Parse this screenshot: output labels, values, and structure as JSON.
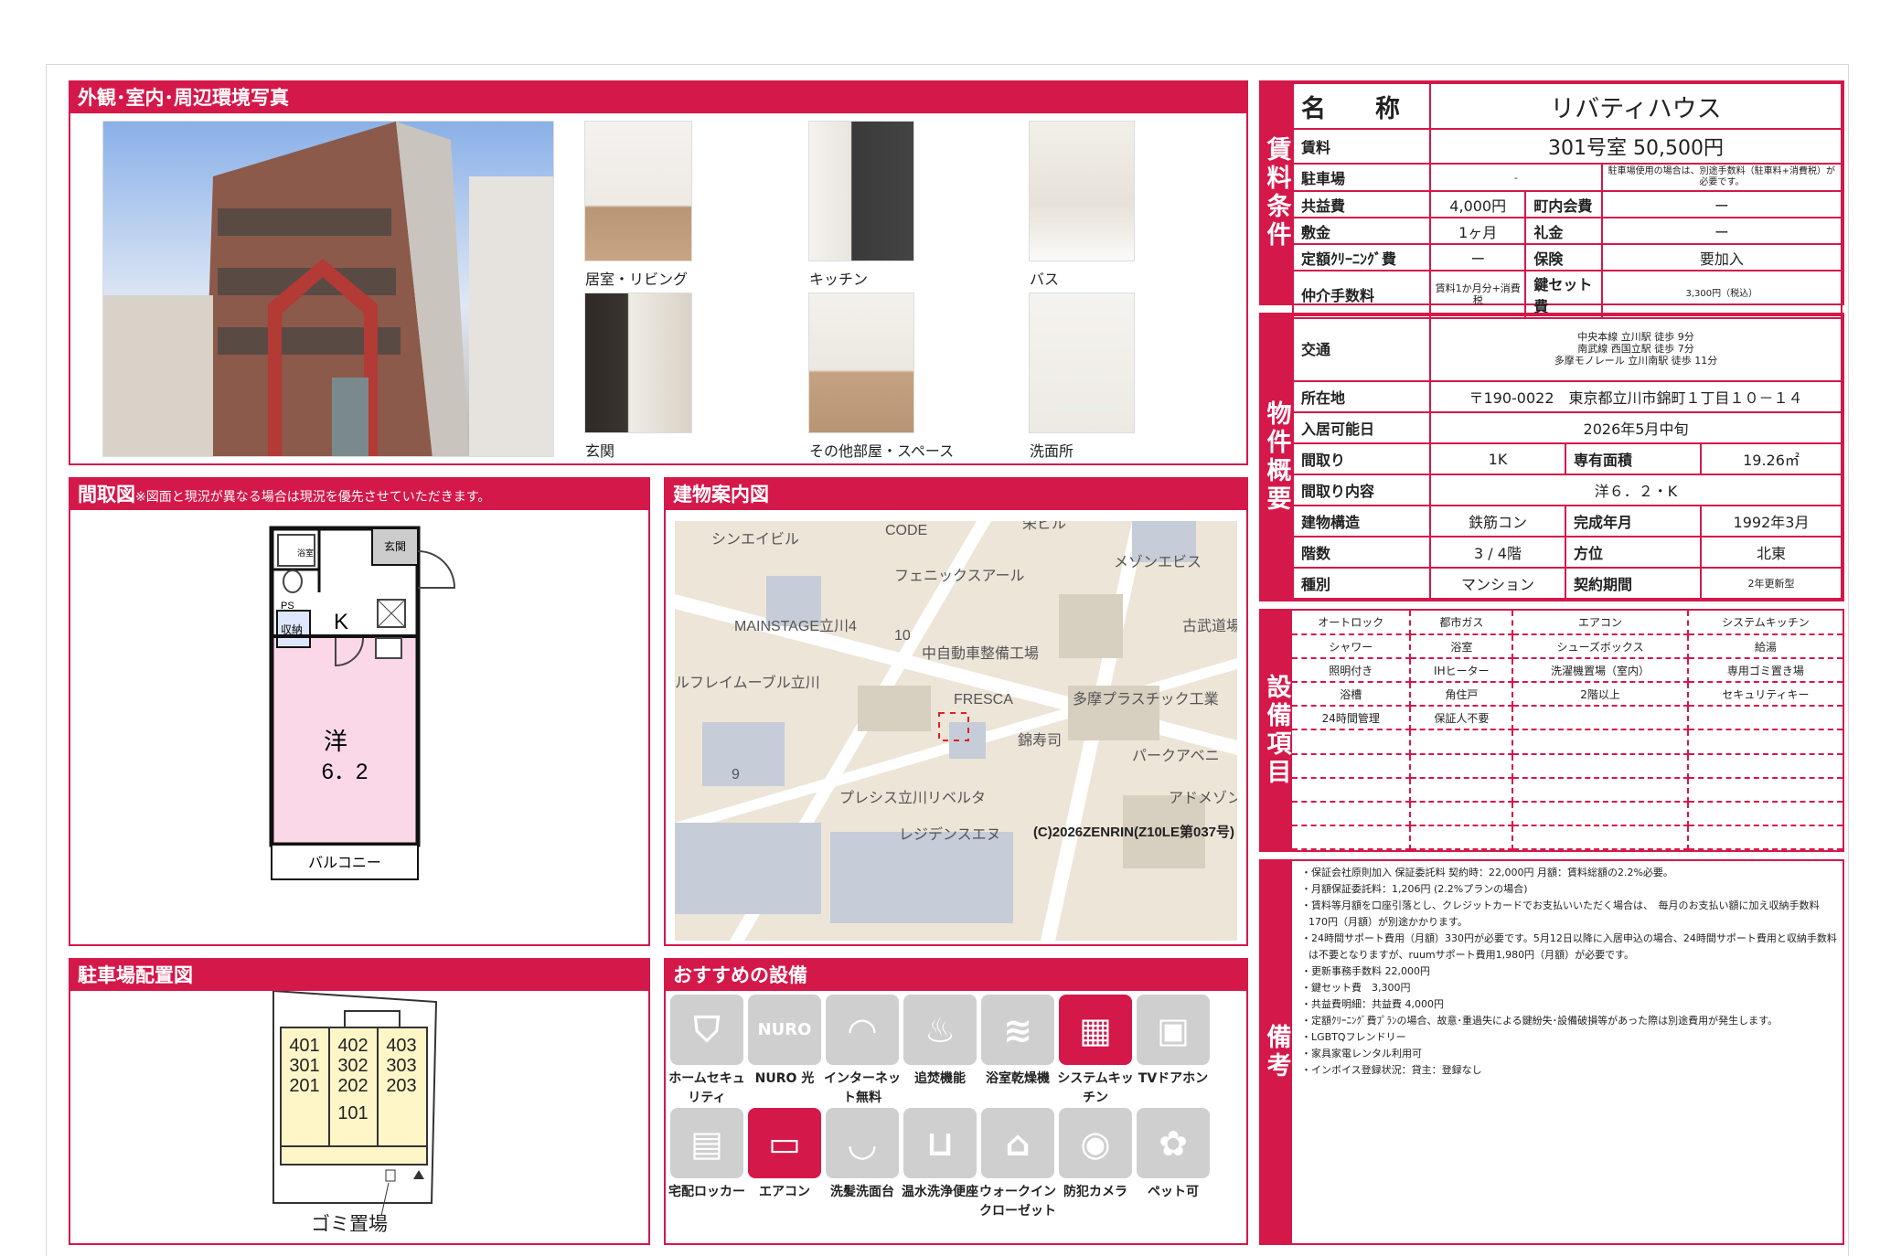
{
  "colors": {
    "accent": "#d4184a",
    "map_bg": "#ece5d8",
    "room_pink": "#fbd8e8",
    "room_yellow": "#fff6c8"
  },
  "photos": {
    "title": "外観･室内･周辺環境写真",
    "captions": [
      "居室・リビング",
      "キッチン",
      "バス",
      "玄関",
      "その他部屋・スペース",
      "洗面所"
    ]
  },
  "floorplan": {
    "title": "間取図",
    "note": "※図面と現況が異なる場合は現況を優先させていただきます。",
    "labels": {
      "entrance": "玄関",
      "kitchen": "K",
      "ps": "PS",
      "storage": "収納",
      "wc": "浴室",
      "room": "洋",
      "room_size": "6．2",
      "balcony": "バルコニー"
    }
  },
  "map": {
    "title": "建物案内図",
    "labels": [
      "シンエイビル",
      "CODE",
      "栄ビル",
      "メゾンエビス",
      "フェニックスアール",
      "MAINSTAGE立川4",
      "10",
      "古武道場",
      "中自動車整備工場",
      "ルフレイムーブル立川",
      "FRESCA",
      "多摩プラスチック工業",
      "錦寿司",
      "パークアベニ",
      "9",
      "プレシス立川リベルタ",
      "アドメゾン",
      "レジデンスエヌ"
    ],
    "copyright": "(C)2026ZENRIN(Z10LE第037号)"
  },
  "parking": {
    "title": "駐車場配置図",
    "rooms": [
      [
        "401",
        "402",
        "403"
      ],
      [
        "301",
        "302",
        "303"
      ],
      [
        "201",
        "202",
        "203"
      ],
      [
        "",
        "101",
        ""
      ]
    ],
    "garbage": "ゴミ置場"
  },
  "facilities_icons": {
    "title": "おすすめの設備",
    "items": [
      {
        "label": "ホームセキュリティ",
        "on": false,
        "icon": "shield-icon"
      },
      {
        "label": "NURO 光",
        "on": false,
        "icon": "nuro-icon"
      },
      {
        "label": "インターネット無料",
        "on": false,
        "icon": "wifi-icon"
      },
      {
        "label": "追焚機能",
        "on": false,
        "icon": "bathtub-icon"
      },
      {
        "label": "浴室乾燥機",
        "on": false,
        "icon": "dryer-icon"
      },
      {
        "label": "システムキッチン",
        "on": true,
        "icon": "kitchen-icon"
      },
      {
        "label": "TVドアホン",
        "on": false,
        "icon": "intercom-icon"
      },
      {
        "label": "宅配ロッカー",
        "on": false,
        "icon": "locker-icon"
      },
      {
        "label": "エアコン",
        "on": true,
        "icon": "aircon-icon"
      },
      {
        "label": "洗髪洗面台",
        "on": false,
        "icon": "washbasin-icon"
      },
      {
        "label": "温水洗浄便座",
        "on": false,
        "icon": "toilet-icon"
      },
      {
        "label": "ウォークインクローゼット",
        "on": false,
        "icon": "closet-icon"
      },
      {
        "label": "防犯カメラ",
        "on": false,
        "icon": "camera-icon"
      },
      {
        "label": "ペット可",
        "on": false,
        "icon": "paw-icon"
      }
    ]
  },
  "rent": {
    "section": "賃料条件",
    "name_label": "名　　称",
    "name": "リバティハウス",
    "rent_label": "賃料",
    "rent": "301号室 50,500円",
    "parking_label": "駐車場",
    "parking": "-",
    "parking_note": "駐車場使用の場合は、別途手数料（駐車料+消費税）が必要です。",
    "common_label": "共益費",
    "common": "4,000円",
    "assoc_label": "町内会費",
    "assoc": "ー",
    "deposit_label": "敷金",
    "deposit": "1ヶ月",
    "key_money_label": "礼金",
    "key_money": "ー",
    "cleaning_label": "定額ｸﾘｰﾆﾝｸﾞ費",
    "cleaning": "ー",
    "insurance_label": "保険",
    "insurance": "要加入",
    "broker_label": "仲介手数料",
    "broker": "賃料1か月分+消費税",
    "keyset_label": "鍵セット費",
    "keyset": "3,300円（税込）"
  },
  "property": {
    "section": "物件概要",
    "access_label": "交通",
    "access": [
      "中央本線 立川駅 徒歩 9分",
      "南武線 西国立駅 徒歩 7分",
      "多摩モノレール 立川南駅 徒歩 11分"
    ],
    "address_label": "所在地",
    "address": "〒190-0022　東京都立川市錦町１丁目１０－１４",
    "movein_label": "入居可能日",
    "movein": "2026年5月中旬",
    "layout_label": "間取り",
    "layout": "1K",
    "area_label": "専有面積",
    "area": "19.26㎡",
    "detail_label": "間取り内容",
    "detail": "洋６．２・K",
    "structure_label": "建物構造",
    "structure": "鉄筋コン",
    "built_label": "完成年月",
    "built": "1992年3月",
    "floor_label": "階数",
    "floor": "3 / 4階",
    "direction_label": "方位",
    "direction": "北東",
    "type_label": "種別",
    "type": "マンション",
    "contract_label": "契約期間",
    "contract": "2年更新型"
  },
  "equipment": {
    "section": "設備項目",
    "rows": [
      [
        "オートロック",
        "都市ガス",
        "エアコン",
        "システムキッチン"
      ],
      [
        "シャワー",
        "浴室",
        "シューズボックス",
        "給湯"
      ],
      [
        "照明付き",
        "IHヒーター",
        "洗濯機置場（室内）",
        "専用ゴミ置き場"
      ],
      [
        "浴槽",
        "角住戸",
        "2階以上",
        "セキュリティキー"
      ],
      [
        "24時間管理",
        "保証人不要",
        "",
        ""
      ],
      [
        "",
        "",
        "",
        ""
      ],
      [
        "",
        "",
        "",
        ""
      ],
      [
        "",
        "",
        "",
        ""
      ],
      [
        "",
        "",
        "",
        ""
      ],
      [
        "",
        "",
        "",
        ""
      ]
    ]
  },
  "remarks": {
    "section": "備考",
    "lines": [
      "・保証会社原則加入 保証委託料 契約時：22,000円 月額：賃料総額の2.2%必要。",
      "・月額保証委託料：1,206円 (2.2%プランの場合)",
      "・賃料等月額を口座引落とし、クレジットカードでお支払いいただく場合は、　毎月のお支払い額に加え収納手数料 170円（月額）が別途かかります。",
      "・24時間サポート費用（月額）330円が必要です。5月12日以降に入居申込の場合、24時間サポート費用と収納手数料は不要となりますが、ruumサポート費用1,980円（月額）が必要です。",
      "・更新事務手数料 22,000円",
      "・鍵セット費　3,300円",
      "・共益費明細：共益費 4,000円",
      "・定額ｸﾘｰﾆﾝｸﾞ費ﾌﾟﾗﾝの場合、故意･重過失による鍵紛失･設備破損等があった際は別途費用が発生します。",
      "・LGBTQフレンドリー",
      "・家具家電レンタル利用可",
      "・インボイス登録状況：貸主：登録なし"
    ]
  }
}
